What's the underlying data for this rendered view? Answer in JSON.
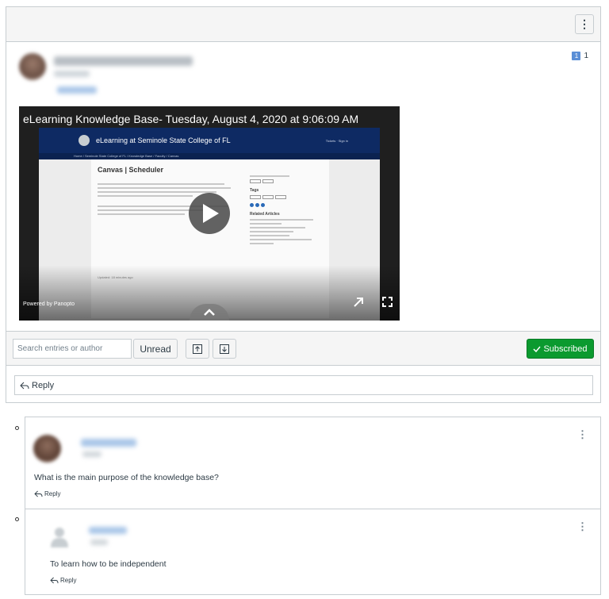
{
  "toolbar_menu": {
    "icon": "kebab-vertical-icon",
    "label": "⋮"
  },
  "post": {
    "unread_badge": "1",
    "reply_count": "1"
  },
  "video": {
    "title": "eLearning Knowledge Base- Tuesday, August 4, 2020 at 9:06:09 AM",
    "site_name": "eLearning at Seminole State College of FL",
    "site_nav": "Tickets · Sign in",
    "breadcrumb": "Home / Seminole State College of FL / Knowledge Base / Faculty / Canvas",
    "page_heading": "Canvas | Scheduler",
    "side_tags_label": "Tags",
    "side_related_label": "Related Articles",
    "updated_text": "Updated: 18 minutes ago",
    "powered_by": "Powered by Panopto"
  },
  "discussion_toolbar": {
    "search_placeholder": "Search entries or author",
    "unread_label": "Unread",
    "subscribed_label": "Subscribed",
    "subscribed_color": "#0b9a2f"
  },
  "reply_bar": {
    "label": "Reply"
  },
  "entries": [
    {
      "text": "What is the main purpose of the knowledge base?",
      "reply_label": "Reply"
    },
    {
      "text": "To learn how to be independent",
      "reply_label": "Reply"
    }
  ]
}
